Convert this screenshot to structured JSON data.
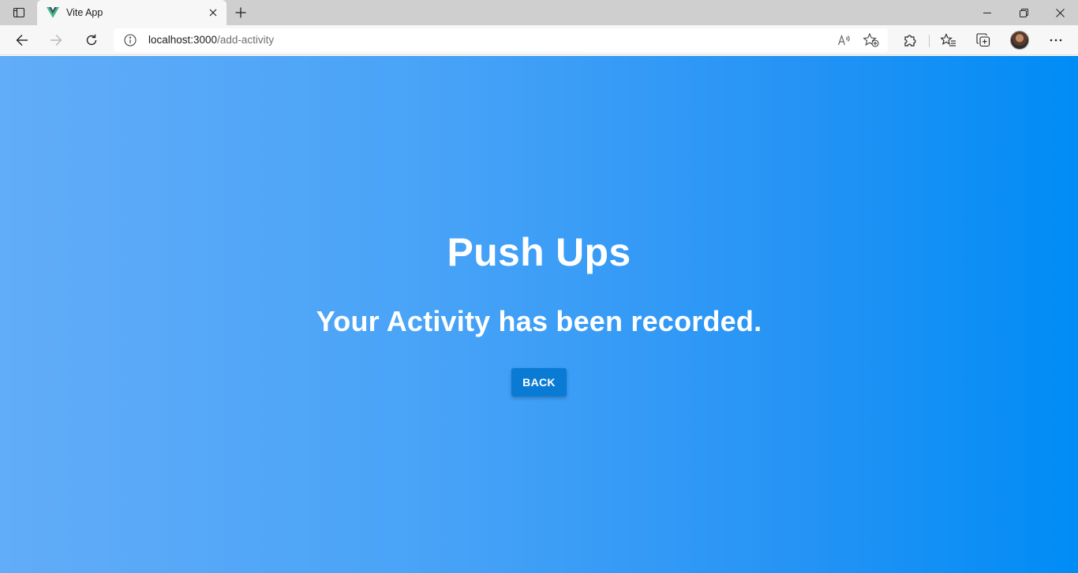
{
  "browser": {
    "tab": {
      "title": "Vite App"
    },
    "address": {
      "host": "localhost:3000",
      "path": "/add-activity"
    }
  },
  "icons": {
    "tab_actions": "tab-actions-icon",
    "favicon": "vue-logo-icon",
    "tab_close": "close-icon",
    "new_tab": "plus-icon",
    "minimize": "minimize-icon",
    "restore": "restore-icon",
    "close_window": "close-icon",
    "back": "arrow-left-icon",
    "forward": "arrow-right-icon",
    "refresh": "refresh-icon",
    "site_info": "info-icon",
    "read_aloud": "read-aloud-icon",
    "add_favorite": "star-plus-icon",
    "extensions": "puzzle-icon",
    "favorites": "favorites-icon",
    "collections": "collections-icon",
    "more": "ellipsis-icon"
  },
  "colors": {
    "gradient_start": "#62acf8",
    "gradient_end": "#008cf5",
    "button_bg": "#0a7bd5",
    "text": "#ffffff",
    "vue_green": "#41b883",
    "vue_dark": "#35495e"
  },
  "main": {
    "activity_name": "Push Ups",
    "message": "Your Activity has been recorded.",
    "back_label": "BACK"
  }
}
